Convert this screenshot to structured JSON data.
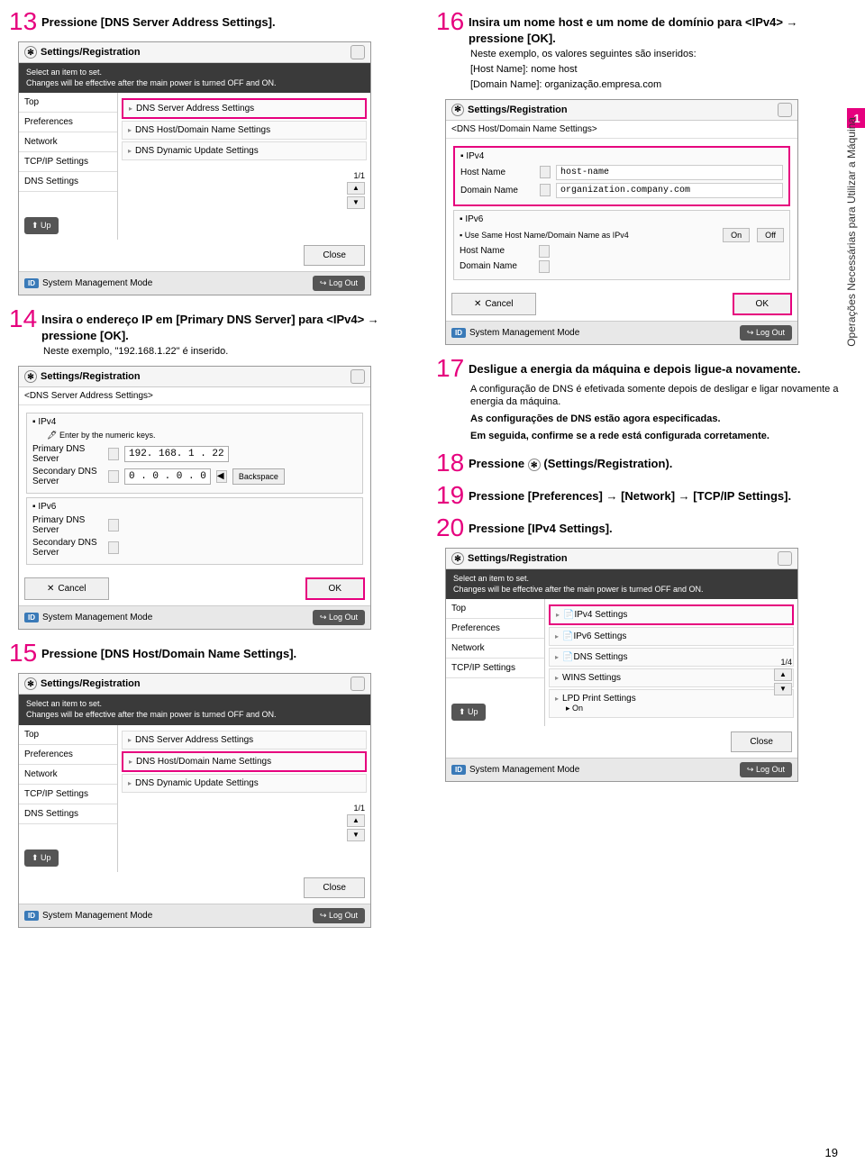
{
  "page_number": "19",
  "sidebar": {
    "tab": "1",
    "label": "Operações Necessárias para Utilizar a Máquina"
  },
  "steps": {
    "s13": {
      "num": "13",
      "text": "Pressione [DNS Server Address Settings]."
    },
    "s14": {
      "num": "14",
      "text": "Insira o endereço IP em [Primary DNS Server] para <IPv4> → pressione [OK].",
      "sub": "Neste exemplo, \"192.168.1.22\" é inserido."
    },
    "s15": {
      "num": "15",
      "text": "Pressione [DNS Host/Domain Name Settings]."
    },
    "s16": {
      "num": "16",
      "text": "Insira um nome host e um nome de domínio para <IPv4> → pressione [OK].",
      "sub1": "Neste exemplo, os valores seguintes são inseridos:",
      "sub2": "[Host Name]: nome host",
      "sub3": "[Domain Name]: organização.empresa.com"
    },
    "s17": {
      "num": "17",
      "text": "Desligue a energia da máquina e depois ligue-a novamente.",
      "sub": "A configuração de DNS é efetivada somente depois de desligar e ligar novamente a energia da máquina.",
      "note1": "As configurações de DNS estão agora especificadas.",
      "note2": "Em seguida, confirme se a rede está configurada corretamente."
    },
    "s18": {
      "num": "18",
      "text_a": "Pressione ",
      "text_b": " (Settings/Registration)."
    },
    "s19": {
      "num": "19",
      "text": "Pressione [Preferences] → [Network] → [TCP/IP Settings]."
    },
    "s20": {
      "num": "20",
      "text": "Pressione [IPv4 Settings]."
    }
  },
  "ui": {
    "title": "Settings/Registration",
    "dark1": "Select an item to set.",
    "dark2": "Changes will be effective after the main power is turned OFF and ON.",
    "left": {
      "top": "Top",
      "pref": "Preferences",
      "net": "Network",
      "tcp": "TCP/IP Settings",
      "dns": "DNS Settings"
    },
    "up": "Up",
    "close": "Close",
    "footer_mode": "System Management Mode",
    "id": "ID",
    "logout": "Log Out",
    "page11": "1/1",
    "page14": "1/4",
    "cancel": "Cancel",
    "ok": "OK",
    "backspace": "Backspace",
    "on": "On",
    "off": "Off"
  },
  "scrA": {
    "r1": "DNS Server Address Settings",
    "r2": "DNS Host/Domain Name Settings",
    "r3": "DNS Dynamic Update Settings"
  },
  "scrB": {
    "crumb": "<DNS Server Address Settings>",
    "ipv4": "IPv4",
    "ipv6": "IPv6",
    "enter": "Enter by the numeric keys.",
    "primary": "Primary DNS Server",
    "secondary": "Secondary DNS Server",
    "ip1": "192. 168. 1 . 22",
    "ip2": "0 . 0 . 0 . 0"
  },
  "scrD": {
    "crumb": "<DNS Host/Domain Name Settings>",
    "ipv4": "IPv4",
    "ipv6": "IPv6",
    "hostname": "Host Name",
    "domainname": "Domain Name",
    "hostval": "host-name",
    "domainval": "organization.company.com",
    "sameopt": "Use Same Host Name/Domain Name as IPv4"
  },
  "scrF": {
    "r1": "IPv4 Settings",
    "r2": "IPv6 Settings",
    "r3": "DNS Settings",
    "r4": "WINS Settings",
    "r5": "LPD Print Settings",
    "r5b": "On"
  }
}
